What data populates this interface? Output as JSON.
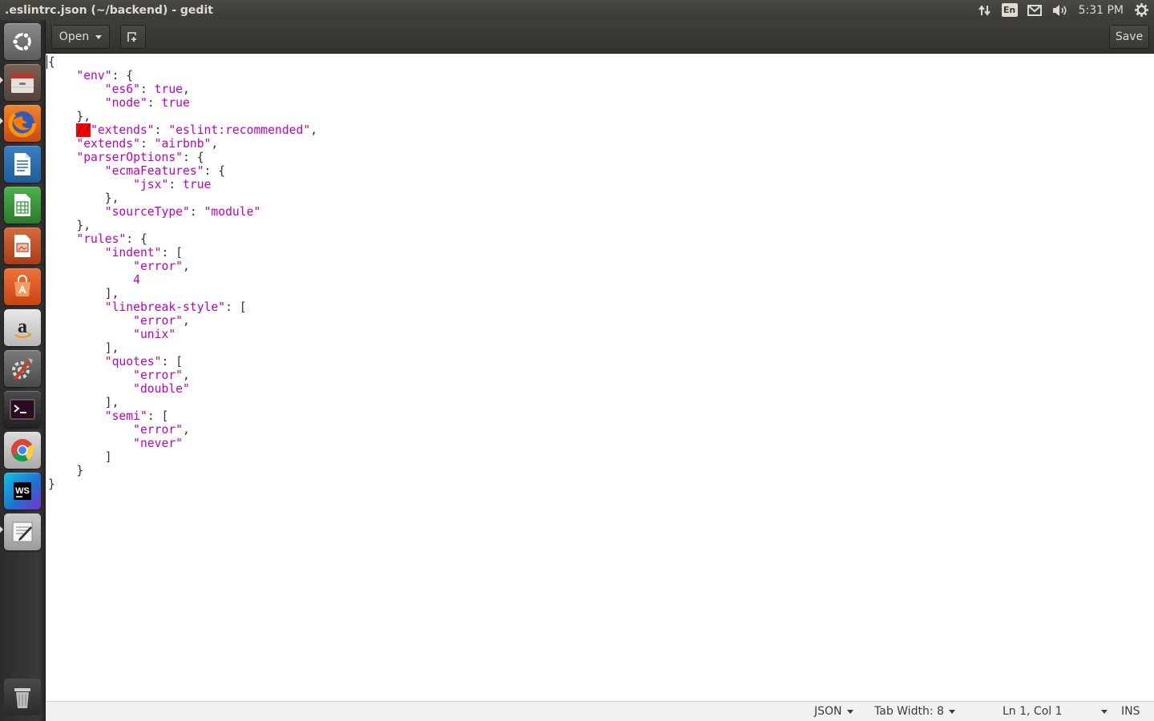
{
  "window": {
    "title": ".eslintrc.json (~/backend) - gedit"
  },
  "top_panel": {
    "indicators": [
      {
        "icon": "network-transfer-icon"
      },
      {
        "icon": "keyboard-layout-icon",
        "label": "En"
      },
      {
        "icon": "mail-icon"
      },
      {
        "icon": "volume-icon"
      }
    ],
    "clock": "5:31 PM",
    "settings_icon": "gear-icon"
  },
  "launcher": {
    "items": [
      {
        "name": "dash-home",
        "icon": "ubuntu-logo-icon",
        "color": "#7f7f7f",
        "running": false
      },
      {
        "name": "files",
        "icon": "file-cabinet-icon",
        "color": "#8a6b58",
        "running": true
      },
      {
        "name": "firefox",
        "icon": "firefox-icon",
        "color": "#e66000",
        "running": true
      },
      {
        "name": "libreoffice-writer",
        "icon": "writer-document-icon",
        "color": "#2a6cb0",
        "running": false
      },
      {
        "name": "libreoffice-calc",
        "icon": "calc-spreadsheet-icon",
        "color": "#3a9a3a",
        "running": false
      },
      {
        "name": "libreoffice-impress",
        "icon": "impress-presentation-icon",
        "color": "#c2502a",
        "running": false
      },
      {
        "name": "ubuntu-software",
        "icon": "shopping-bag-icon",
        "color": "#e9561b",
        "running": false
      },
      {
        "name": "amazon",
        "icon": "amazon-icon",
        "color": "#d8d8d8",
        "running": false
      },
      {
        "name": "system-settings",
        "icon": "system-settings-icon",
        "color": "#6a6a6a",
        "running": false
      },
      {
        "name": "terminal",
        "icon": "terminal-icon",
        "color": "#2f2f2f",
        "running": false
      },
      {
        "name": "chrome",
        "icon": "chrome-icon",
        "color": "#cfcfcf",
        "running": false
      },
      {
        "name": "webstorm",
        "icon": "webstorm-icon",
        "color": "#1c8fd0",
        "running": false
      },
      {
        "name": "gedit",
        "icon": "text-editor-icon",
        "color": "#b7b7b7",
        "running": true
      },
      {
        "name": "trash",
        "icon": "trash-icon",
        "color": "#3a3a3a",
        "running": false
      }
    ]
  },
  "toolbar": {
    "open_label": "Open",
    "new_tab_icon": "new-document-icon",
    "save_label": "Save"
  },
  "editor": {
    "lines": [
      [
        {
          "t": "p",
          "v": "{"
        }
      ],
      [
        {
          "t": "p",
          "v": "    "
        },
        {
          "t": "s",
          "v": "\"env\""
        },
        {
          "t": "p",
          "v": ": {"
        }
      ],
      [
        {
          "t": "p",
          "v": "        "
        },
        {
          "t": "s",
          "v": "\"es6\""
        },
        {
          "t": "p",
          "v": ": "
        },
        {
          "t": "k",
          "v": "true"
        },
        {
          "t": "p",
          "v": ","
        }
      ],
      [
        {
          "t": "p",
          "v": "        "
        },
        {
          "t": "s",
          "v": "\"node\""
        },
        {
          "t": "p",
          "v": ": "
        },
        {
          "t": "k",
          "v": "true"
        }
      ],
      [
        {
          "t": "p",
          "v": "    },"
        }
      ],
      [
        {
          "t": "p",
          "v": "    "
        },
        {
          "t": "e",
          "v": "//"
        },
        {
          "t": "s",
          "v": "\"extends\""
        },
        {
          "t": "p",
          "v": ": "
        },
        {
          "t": "s",
          "v": "\"eslint:recommended\""
        },
        {
          "t": "p",
          "v": ","
        }
      ],
      [
        {
          "t": "p",
          "v": "    "
        },
        {
          "t": "s",
          "v": "\"extends\""
        },
        {
          "t": "p",
          "v": ": "
        },
        {
          "t": "s",
          "v": "\"airbnb\""
        },
        {
          "t": "p",
          "v": ","
        }
      ],
      [
        {
          "t": "p",
          "v": "    "
        },
        {
          "t": "s",
          "v": "\"parserOptions\""
        },
        {
          "t": "p",
          "v": ": {"
        }
      ],
      [
        {
          "t": "p",
          "v": "        "
        },
        {
          "t": "s",
          "v": "\"ecmaFeatures\""
        },
        {
          "t": "p",
          "v": ": {"
        }
      ],
      [
        {
          "t": "p",
          "v": "            "
        },
        {
          "t": "s",
          "v": "\"jsx\""
        },
        {
          "t": "p",
          "v": ": "
        },
        {
          "t": "k",
          "v": "true"
        }
      ],
      [
        {
          "t": "p",
          "v": "        },"
        }
      ],
      [
        {
          "t": "p",
          "v": "        "
        },
        {
          "t": "s",
          "v": "\"sourceType\""
        },
        {
          "t": "p",
          "v": ": "
        },
        {
          "t": "s",
          "v": "\"module\""
        }
      ],
      [
        {
          "t": "p",
          "v": "    },"
        }
      ],
      [
        {
          "t": "p",
          "v": "    "
        },
        {
          "t": "s",
          "v": "\"rules\""
        },
        {
          "t": "p",
          "v": ": {"
        }
      ],
      [
        {
          "t": "p",
          "v": "        "
        },
        {
          "t": "s",
          "v": "\"indent\""
        },
        {
          "t": "p",
          "v": ": ["
        }
      ],
      [
        {
          "t": "p",
          "v": "            "
        },
        {
          "t": "s",
          "v": "\"error\""
        },
        {
          "t": "p",
          "v": ","
        }
      ],
      [
        {
          "t": "p",
          "v": "            "
        },
        {
          "t": "n",
          "v": "4"
        }
      ],
      [
        {
          "t": "p",
          "v": "        ],"
        }
      ],
      [
        {
          "t": "p",
          "v": "        "
        },
        {
          "t": "s",
          "v": "\"linebreak-style\""
        },
        {
          "t": "p",
          "v": ": ["
        }
      ],
      [
        {
          "t": "p",
          "v": "            "
        },
        {
          "t": "s",
          "v": "\"error\""
        },
        {
          "t": "p",
          "v": ","
        }
      ],
      [
        {
          "t": "p",
          "v": "            "
        },
        {
          "t": "s",
          "v": "\"unix\""
        }
      ],
      [
        {
          "t": "p",
          "v": "        ],"
        }
      ],
      [
        {
          "t": "p",
          "v": "        "
        },
        {
          "t": "s",
          "v": "\"quotes\""
        },
        {
          "t": "p",
          "v": ": ["
        }
      ],
      [
        {
          "t": "p",
          "v": "            "
        },
        {
          "t": "s",
          "v": "\"error\""
        },
        {
          "t": "p",
          "v": ","
        }
      ],
      [
        {
          "t": "p",
          "v": "            "
        },
        {
          "t": "s",
          "v": "\"double\""
        }
      ],
      [
        {
          "t": "p",
          "v": "        ],"
        }
      ],
      [
        {
          "t": "p",
          "v": "        "
        },
        {
          "t": "s",
          "v": "\"semi\""
        },
        {
          "t": "p",
          "v": ": ["
        }
      ],
      [
        {
          "t": "p",
          "v": "            "
        },
        {
          "t": "s",
          "v": "\"error\""
        },
        {
          "t": "p",
          "v": ","
        }
      ],
      [
        {
          "t": "p",
          "v": "            "
        },
        {
          "t": "s",
          "v": "\"never\""
        }
      ],
      [
        {
          "t": "p",
          "v": "        ]"
        }
      ],
      [
        {
          "t": "p",
          "v": "    }"
        }
      ],
      [
        {
          "t": "p",
          "v": "}"
        }
      ]
    ]
  },
  "status_bar": {
    "language": "JSON",
    "tab_width": "Tab Width: 8",
    "position": "Ln 1, Col 1",
    "mode": "INS"
  }
}
